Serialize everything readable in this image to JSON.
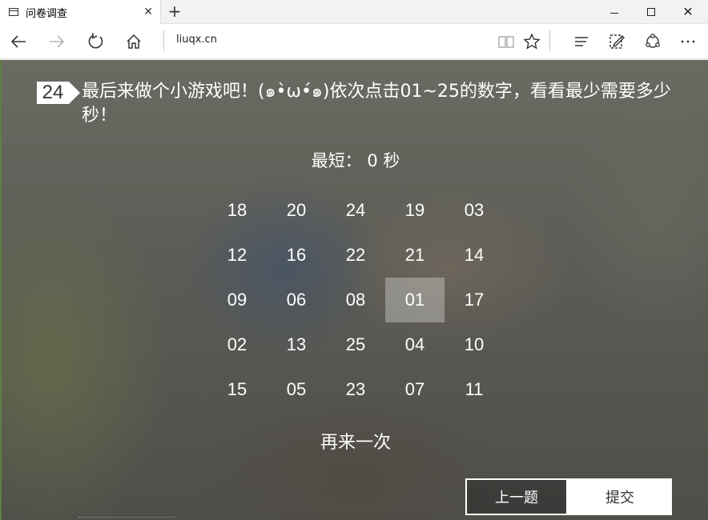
{
  "browser": {
    "tab_title": "问卷调查",
    "tab_close": "✕",
    "new_tab": "+",
    "url": "liuqx.cn"
  },
  "icons": [
    "tab-page-icon",
    "back-arrow-icon",
    "forward-arrow-icon",
    "refresh-icon",
    "home-icon",
    "reading-view-icon",
    "favorite-star-icon",
    "hub-icon",
    "web-note-icon",
    "share-icon",
    "more-icon"
  ],
  "question": {
    "number": "24",
    "text": "最后来做个小游戏吧！(๑•̀ω•́๑)依次点击01~25的数字，看看最少需要多少秒！"
  },
  "game": {
    "timer": "最短： 0 秒",
    "cells": [
      "18",
      "20",
      "24",
      "19",
      "03",
      "12",
      "16",
      "22",
      "21",
      "14",
      "09",
      "06",
      "08",
      "01",
      "17",
      "02",
      "13",
      "25",
      "04",
      "10",
      "15",
      "05",
      "23",
      "07",
      "11"
    ],
    "highlighted": "01",
    "retry": "再来一次"
  },
  "buttons": {
    "prev": "上一题",
    "submit": "提交"
  },
  "colors": {
    "accent_border": "#5e7f45",
    "overlay_text": "#ffffff"
  }
}
